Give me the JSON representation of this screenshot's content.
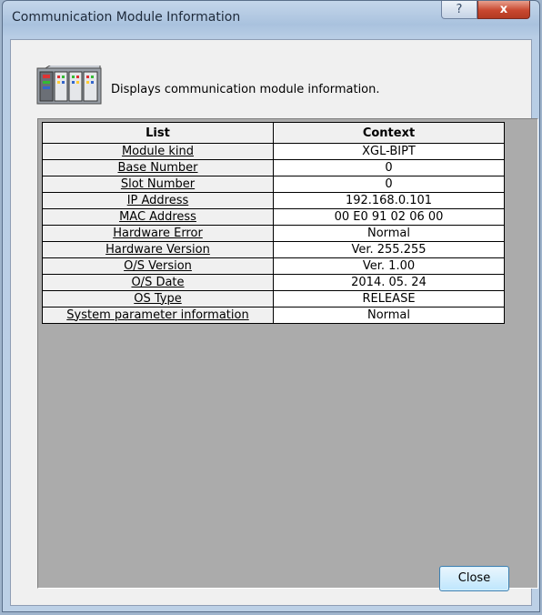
{
  "window": {
    "title": "Communication Module Information",
    "help_label": "?",
    "close_label": "x"
  },
  "header": {
    "icon": "communication-module-icon",
    "text": "Displays communication module information."
  },
  "table": {
    "columns": [
      "List",
      "Context"
    ],
    "rows": [
      {
        "key": "Module kind",
        "value": "XGL-BIPT"
      },
      {
        "key": "Base Number",
        "value": "0"
      },
      {
        "key": "Slot Number",
        "value": "0"
      },
      {
        "key": "IP Address",
        "value": "192.168.0.101"
      },
      {
        "key": "MAC Address",
        "value": "00 E0 91 02 06 00"
      },
      {
        "key": "Hardware Error",
        "value": "Normal"
      },
      {
        "key": "Hardware Version",
        "value": "Ver. 255.255"
      },
      {
        "key": "O/S Version",
        "value": "Ver. 1.00"
      },
      {
        "key": "O/S Date",
        "value": "2014. 05. 24"
      },
      {
        "key": "OS Type",
        "value": "RELEASE"
      },
      {
        "key": "System parameter information",
        "value": "Normal"
      }
    ]
  },
  "footer": {
    "close_button": "Close"
  },
  "colors": {
    "dialog_bg": "#f0f0f0",
    "list_bg": "#ababab",
    "titlebar_close": "#c8482f"
  }
}
